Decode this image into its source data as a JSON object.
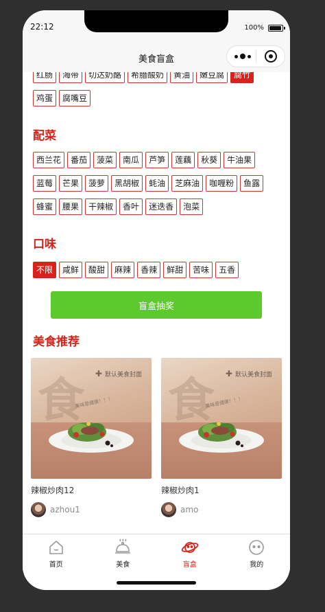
{
  "status_bar": {
    "time": "22:12",
    "battery": "100%"
  },
  "navbar": {
    "title": "美食盲盒"
  },
  "main_ingredients": {
    "partial_row": [
      "红肠",
      "海带",
      "切达奶酪",
      "希腊酸奶",
      "黄油",
      "嫩豆腐",
      "腐竹"
    ],
    "active": "腐竹",
    "row": [
      "鸡蛋",
      "腐嘴豆"
    ]
  },
  "side_dishes": {
    "title": "配菜",
    "rows": [
      [
        "西兰花",
        "番茄",
        "菠菜",
        "南瓜",
        "芦笋",
        "莲藕",
        "秋葵",
        "牛油果"
      ],
      [
        "蓝莓",
        "芒果",
        "菠萝",
        "黑胡椒",
        "蚝油",
        "芝麻油",
        "咖喱粉",
        "鱼露"
      ],
      [
        "蜂蜜",
        "腰果",
        "干辣椒",
        "香叶",
        "迷迭香",
        "泡菜"
      ]
    ]
  },
  "tastes": {
    "title": "口味",
    "items": [
      "不限",
      "咸鲜",
      "酸甜",
      "麻辣",
      "香辣",
      "鲜甜",
      "苦味",
      "五香"
    ],
    "active": "不限"
  },
  "draw_button": {
    "label": "盲盒抽奖"
  },
  "recommend": {
    "title": "美食推荐",
    "cards": [
      {
        "image_caption": "默认美食封面",
        "image_subcaption": "美味是健康！！！",
        "image_char": "食",
        "title": "辣椒炒肉12",
        "user": "azhou1"
      },
      {
        "image_caption": "默认美食封面",
        "image_subcaption": "美味是健康！！！",
        "image_char": "食",
        "title": "辣椒炒肉1",
        "user": "amo"
      }
    ]
  },
  "tabbar": {
    "items": [
      {
        "label": "首页",
        "icon": "home-icon"
      },
      {
        "label": "美食",
        "icon": "food-cloche-icon"
      },
      {
        "label": "盲盒",
        "icon": "planet-icon"
      },
      {
        "label": "我的",
        "icon": "face-icon"
      }
    ],
    "active_index": 2
  },
  "colors": {
    "accent": "#d7231a",
    "button": "#5cc92c",
    "tag_border": "#c9362b"
  }
}
